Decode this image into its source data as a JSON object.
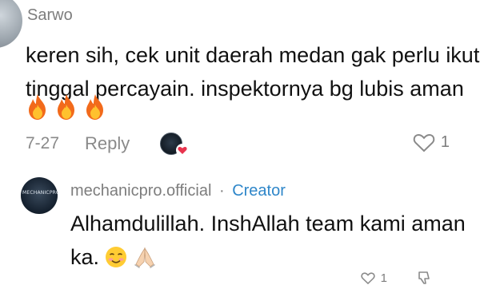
{
  "comment": {
    "username": "Sarwo",
    "text_lines": [
      "keren sih, cek unit daerah medan gak perlu ikut",
      "tinggal percayain. inspektornya bg lubis aman"
    ],
    "emojis": [
      "fire-emoji",
      "fire-emoji",
      "fire-emoji"
    ],
    "date": "7-27",
    "reply_label": "Reply",
    "like_count": "1"
  },
  "reply": {
    "username": "mechanicpro.official",
    "separator": "·",
    "badge": "Creator",
    "text_line1": "Alhamdulillah. InshAllah team kami aman",
    "text_line2": "ka.",
    "avatar_text": "MECHANICPRO",
    "like_count": "1"
  },
  "colors": {
    "creator_badge": "#2e86c9",
    "heart_badge": "#e8344e",
    "muted_text": "#8a8a8a"
  }
}
